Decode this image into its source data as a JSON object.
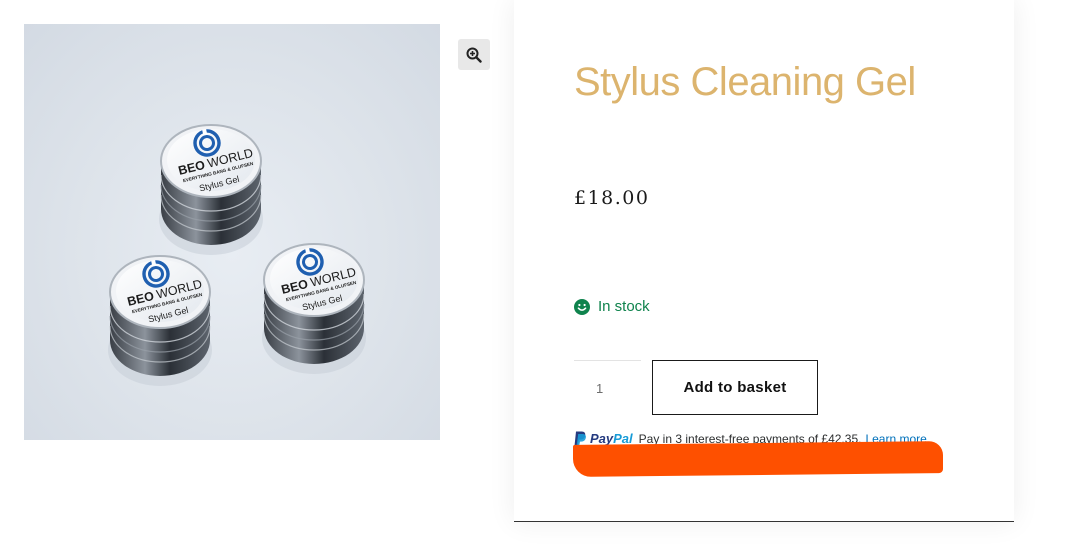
{
  "product": {
    "title": "Stylus Cleaning Gel",
    "price": "£18.00",
    "stock_status": "In stock",
    "image_label": {
      "brand": "BEOWORLD",
      "tagline": "EVERYTHING BANG & OLUFSEN",
      "product": "Stylus Gel"
    }
  },
  "icons": {
    "zoom": "zoom-in-icon",
    "stock": "smiley-check-icon",
    "paypal": "paypal-logo-icon"
  },
  "purchase": {
    "quantity": "1",
    "add_to_basket_label": "Add to basket"
  },
  "paypal": {
    "logo_pay": "Pay",
    "logo_pal": "Pal",
    "message": "Pay in 3 interest-free payments of £42.35.",
    "link": "Learn more"
  },
  "colors": {
    "title": "#dcb46e",
    "in_stock": "#0f834d",
    "paypal_dark": "#253b80",
    "paypal_light": "#179bd7",
    "paypal_link": "#0070ba",
    "redaction": "#fe5000"
  }
}
